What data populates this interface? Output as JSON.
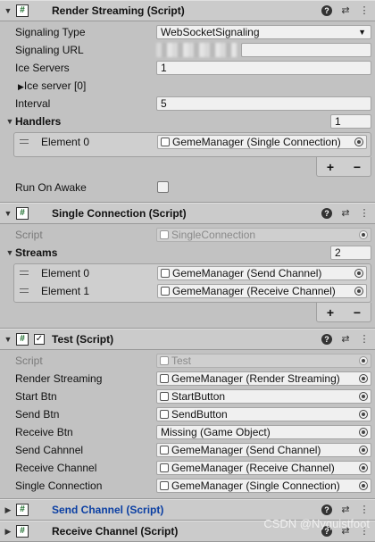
{
  "components": [
    {
      "title": "Render Streaming (Script)",
      "fields": [
        {
          "label": "Signaling Type",
          "value": "WebSocketSignaling"
        },
        {
          "label": "Signaling URL"
        },
        {
          "label": "Ice Servers",
          "value": "1"
        },
        {
          "label": "Ice server [0]"
        },
        {
          "label": "Interval",
          "value": "5"
        }
      ],
      "handlers": {
        "label": "Handlers",
        "size": "1",
        "elements": [
          {
            "label": "Element 0",
            "value": "GemeManager (Single Connection)"
          }
        ]
      },
      "run_on_awake": "Run On Awake"
    },
    {
      "title": "Single Connection (Script)",
      "script_label": "Script",
      "script_value": "SingleConnection",
      "streams": {
        "label": "Streams",
        "size": "2",
        "elements": [
          {
            "label": "Element 0",
            "value": "GemeManager (Send Channel)"
          },
          {
            "label": "Element 1",
            "value": "GemeManager (Receive Channel)"
          }
        ]
      }
    },
    {
      "title": "Test (Script)",
      "script_label": "Script",
      "script_value": "Test",
      "fields": [
        {
          "label": "Render Streaming",
          "value": "GemeManager (Render Streaming)"
        },
        {
          "label": "Start Btn",
          "value": "StartButton"
        },
        {
          "label": "Send Btn",
          "value": "SendButton"
        },
        {
          "label": "Receive Btn",
          "value": "Missing (Game Object)"
        },
        {
          "label": "Send Cahnnel",
          "value": "GemeManager (Send Channel)"
        },
        {
          "label": "Receive Channel",
          "value": "GemeManager (Receive Channel)"
        },
        {
          "label": "Single Connection",
          "value": "GemeManager (Single Connection)"
        }
      ]
    },
    {
      "title": "Send Channel (Script)"
    },
    {
      "title": "Receive Channel (Script)"
    }
  ],
  "glyphs": {
    "plus": "+",
    "minus": "−",
    "help": "?",
    "presets": "⇄",
    "menu": "⋮",
    "expanded": "▼",
    "collapsed": "▶",
    "hash": "#",
    "check": "✓",
    "dropdown": "▼"
  },
  "watermark": "CSDN @Nyquistfoot"
}
